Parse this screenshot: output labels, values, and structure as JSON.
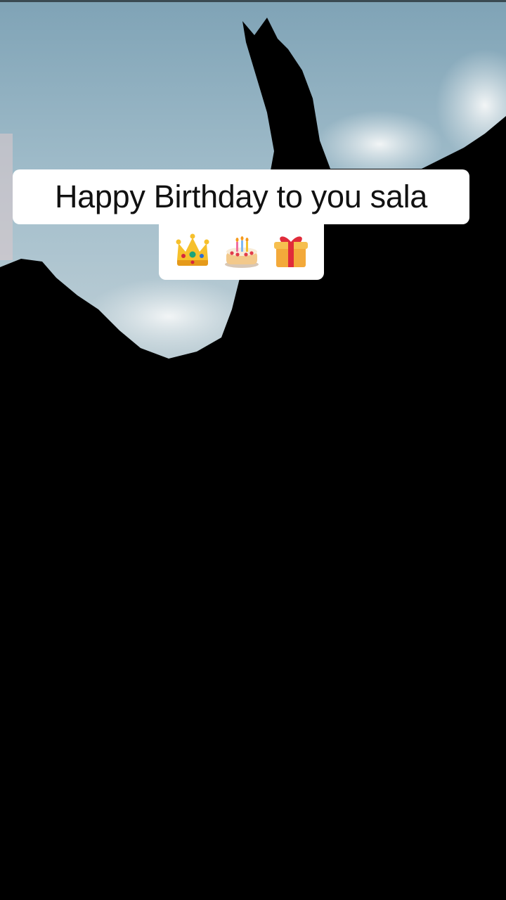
{
  "video_frame": {
    "caption": {
      "line1": "Happy Birthday to you sala",
      "emojis": [
        {
          "icon": "crown-icon",
          "char": "👑"
        },
        {
          "icon": "birthday-cake-icon",
          "char": "🎂"
        },
        {
          "icon": "gift-icon",
          "char": "🎁"
        }
      ]
    },
    "colors": {
      "sky": "#9fbac8",
      "cloud": "#e9eef0",
      "silhouette": "#000000",
      "caption_bg": "#ffffff",
      "caption_text": "#111111"
    }
  }
}
